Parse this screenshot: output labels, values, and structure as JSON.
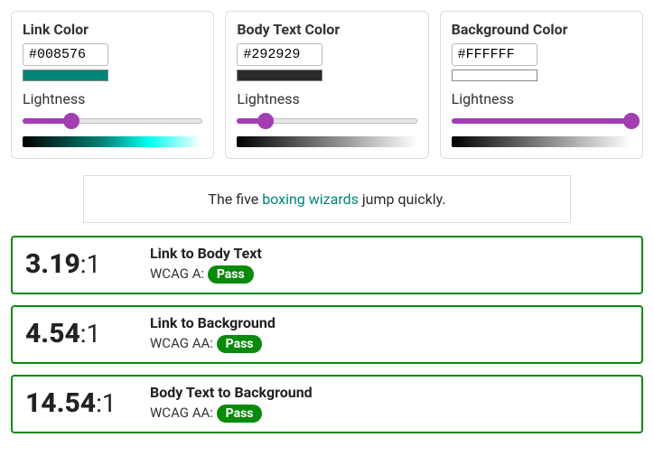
{
  "panels": {
    "link": {
      "title": "Link Color",
      "hex": "#008576",
      "lightness_label": "Lightness",
      "slider_percent": 27,
      "gradient_css": "linear-gradient(to right, #000000, #008576 45%, #00fff0 70%, #ffffff)"
    },
    "body": {
      "title": "Body Text Color",
      "hex": "#292929",
      "lightness_label": "Lightness",
      "slider_percent": 16,
      "gradient_css": "linear-gradient(to right, #000000, #292929 16%, #ffffff)"
    },
    "bg": {
      "title": "Background Color",
      "hex": "#FFFFFF",
      "lightness_label": "Lightness",
      "slider_percent": 100,
      "gradient_css": "linear-gradient(to right, #000000, #ffffff)"
    }
  },
  "sample": {
    "pre": "The five ",
    "link_text": "boxing wizards",
    "post": " jump quickly.",
    "link_color": "#008576",
    "body_color": "#292929",
    "bg_color": "#FFFFFF"
  },
  "results": [
    {
      "ratio": "3.19",
      "suffix": ":1",
      "title": "Link to Body Text",
      "wcag_label": "WCAG A: ",
      "status": "Pass"
    },
    {
      "ratio": "4.54",
      "suffix": ":1",
      "title": "Link to Background",
      "wcag_label": "WCAG AA: ",
      "status": "Pass"
    },
    {
      "ratio": "14.54",
      "suffix": ":1",
      "title": "Body Text to Background",
      "wcag_label": "WCAG AA: ",
      "status": "Pass"
    }
  ]
}
